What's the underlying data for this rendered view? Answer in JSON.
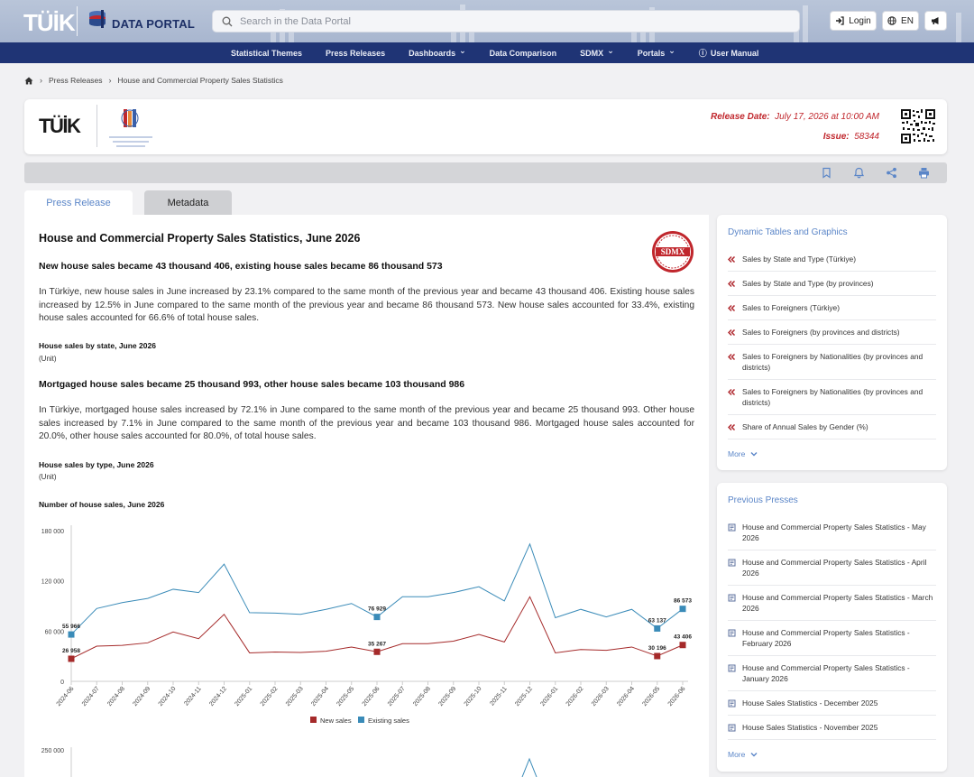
{
  "header": {
    "logo_tuik": "TÜİK",
    "logo_portal": "DATA PORTAL",
    "search_placeholder": "Search in the Data Portal",
    "login_label": "Login",
    "lang_label": "EN"
  },
  "nav": {
    "items": [
      {
        "label": "Statistical Themes",
        "dropdown": false
      },
      {
        "label": "Press Releases",
        "dropdown": false
      },
      {
        "label": "Dashboards",
        "dropdown": true
      },
      {
        "label": "Data Comparison",
        "dropdown": false
      },
      {
        "label": "SDMX",
        "dropdown": true
      },
      {
        "label": "Portals",
        "dropdown": true
      },
      {
        "label": "User Manual",
        "dropdown": false
      }
    ]
  },
  "breadcrumb": {
    "items": [
      "Press Releases",
      "House and Commercial Property Sales Statistics"
    ]
  },
  "release": {
    "date_label": "Release Date:",
    "date_value": "July 17, 2026 at 10:00 AM",
    "issue_label": "Issue:",
    "issue_value": "58344",
    "partner_name": "General Directorate of Land Registry and Cadastre"
  },
  "tabs": {
    "active": "Press Release",
    "inactive": "Metadata"
  },
  "main": {
    "title": "House and Commercial Property Sales Statistics, June 2026",
    "sdmx_badge": "SDMX",
    "h1": "New house sales became 43 thousand 406, existing house sales became 86 thousand 573",
    "p1": "In Türkiye, new house sales in June increased by 23.1% compared to the same month of the previous year and became 43 thousand 406. Existing house sales increased by 12.5% in June compared to the same month of the previous year and became 86 thousand 573. New house sales accounted for 33.4%, existing house sales accounted for 66.6% of total house sales.",
    "t1": "House sales by state, June 2026",
    "u1": "(Unit)",
    "h2": "Mortgaged house sales became 25 thousand 993, other house sales became 103 thousand 986",
    "p2": "In Türkiye, mortgaged house sales increased by 72.1% in June compared to the same month of the previous year and became 25 thousand 993. Other house sales increased by 7.1% in June compared to the same month of the previous year and became 103 thousand 986. Mortgaged house sales accounted for 20.0%, other house sales accounted for 80.0%, of total house sales.",
    "t2": "House sales by type, June 2026",
    "u2": "(Unit)",
    "t3": "Number of house sales, June 2026"
  },
  "chart_data": {
    "type": "line",
    "x": [
      "2024-06",
      "2024-07",
      "2024-08",
      "2024-09",
      "2024-10",
      "2024-11",
      "2024-12",
      "2025-01",
      "2025-02",
      "2025-03",
      "2025-04",
      "2025-05",
      "2025-06",
      "2025-07",
      "2025-08",
      "2025-09",
      "2025-10",
      "2025-11",
      "2025-12",
      "2026-01",
      "2026-02",
      "2026-03",
      "2026-04",
      "2026-05",
      "2026-06"
    ],
    "ylim": [
      0,
      180000
    ],
    "yticks": [
      "0",
      "60 000",
      "120 000",
      "180 000"
    ],
    "series": [
      {
        "name": "New sales",
        "color": "#a52a2a",
        "values": [
          26958,
          42000,
          43000,
          46000,
          59000,
          51000,
          80000,
          34000,
          35000,
          34500,
          36000,
          41000,
          35267,
          45000,
          45000,
          48000,
          56000,
          47000,
          101000,
          34000,
          38000,
          37000,
          41000,
          30196,
          43406
        ],
        "labels": {
          "0": "26 958",
          "12": "35 267",
          "23": "30 196",
          "24": "43 406"
        }
      },
      {
        "name": "Existing sales",
        "color": "#3a8bb8",
        "values": [
          55966,
          87000,
          94000,
          99000,
          110000,
          106000,
          140000,
          82000,
          81500,
          80000,
          86000,
          93000,
          76929,
          101000,
          101000,
          106000,
          113000,
          96000,
          164000,
          76000,
          86000,
          77000,
          86000,
          63137,
          86573
        ],
        "labels": {
          "0": "55 966",
          "12": "76 929",
          "23": "63 137",
          "24": "86 573"
        }
      }
    ],
    "second_chart_ytick": "250 000"
  },
  "dynamic_tables": {
    "title": "Dynamic Tables and Graphics",
    "items": [
      "Sales by State and Type (Türkiye)",
      "Sales by State and Type (by provinces)",
      "Sales to Foreigners (Türkiye)",
      "Sales to Foreigners (by provinces and districts)",
      "Sales to Foreigners by Nationalities (by provinces and districts)",
      "Sales to Foreigners by Nationalities (by provinces and districts)",
      "Share of Annual Sales by Gender (%)"
    ],
    "more": "More"
  },
  "previous": {
    "title": "Previous Presses",
    "items": [
      "House and Commercial Property Sales Statistics - May 2026",
      "House and Commercial Property Sales Statistics - April 2026",
      "House and Commercial Property Sales Statistics - March 2026",
      "House and Commercial Property Sales Statistics - February 2026",
      "House and Commercial Property Sales Statistics - January 2026",
      "House Sales Statistics - December 2025",
      "House Sales Statistics - November 2025"
    ],
    "more": "More"
  }
}
